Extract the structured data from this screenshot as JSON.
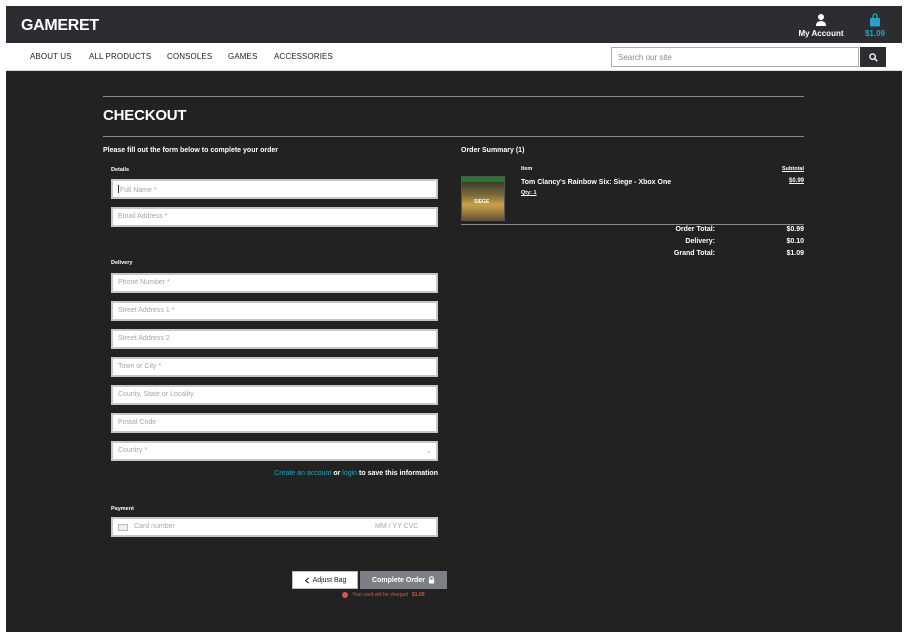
{
  "header": {
    "logo": "GAMERET",
    "account_label": "My Account",
    "bag_total": "$1.09"
  },
  "nav": {
    "items": [
      "ABOUT US",
      "ALL PRODUCTS",
      "CONSOLES",
      "GAMES",
      "ACCESSORIES"
    ],
    "search_placeholder": "Search our site"
  },
  "checkout": {
    "title": "CHECKOUT",
    "instruction": "Please fill out the form below to complete your order",
    "details_label": "Details",
    "details_fields": {
      "full_name": "Full Name *",
      "email": "Email Address *"
    },
    "delivery_label": "Delivery",
    "delivery_fields": {
      "phone": "Phone Number *",
      "street1": "Street Address 1 *",
      "street2": "Street Address 2",
      "town": "Town or City *",
      "county": "County, State or Locality",
      "postal": "Postal Code",
      "country": "Country *"
    },
    "account_prompt": {
      "create_link": "Create an account",
      "or_text": "or",
      "login_link": "login",
      "suffix": "to save this information"
    },
    "payment_label": "Payment",
    "card": {
      "number_placeholder": "Card number",
      "expiry_cvc_placeholder": "MM / YY  CVC"
    },
    "adjust_button": "Adjust Bag",
    "complete_button": "Complete Order",
    "charge_note_text": "Your card will be charged",
    "charge_amount": "$1.09"
  },
  "order_summary": {
    "title": "Order Summary (1)",
    "col_item": "Item",
    "col_subtotal": "Subtotal",
    "product": {
      "name": "Tom Clancy's Rainbow Six: Siege - Xbox One",
      "qty": "Qty: 1",
      "price": "$0.99",
      "cover_text": "SIEGE"
    },
    "totals": {
      "order_total_label": "Order Total:",
      "order_total": "$0.99",
      "delivery_label": "Delivery:",
      "delivery": "$0.10",
      "grand_total_label": "Grand Total:",
      "grand_total": "$1.09"
    }
  },
  "colors": {
    "page_bg": "#222222",
    "header_bg": "#2b2d31",
    "accent": "#23a3c7",
    "warning": "#d9534f"
  }
}
